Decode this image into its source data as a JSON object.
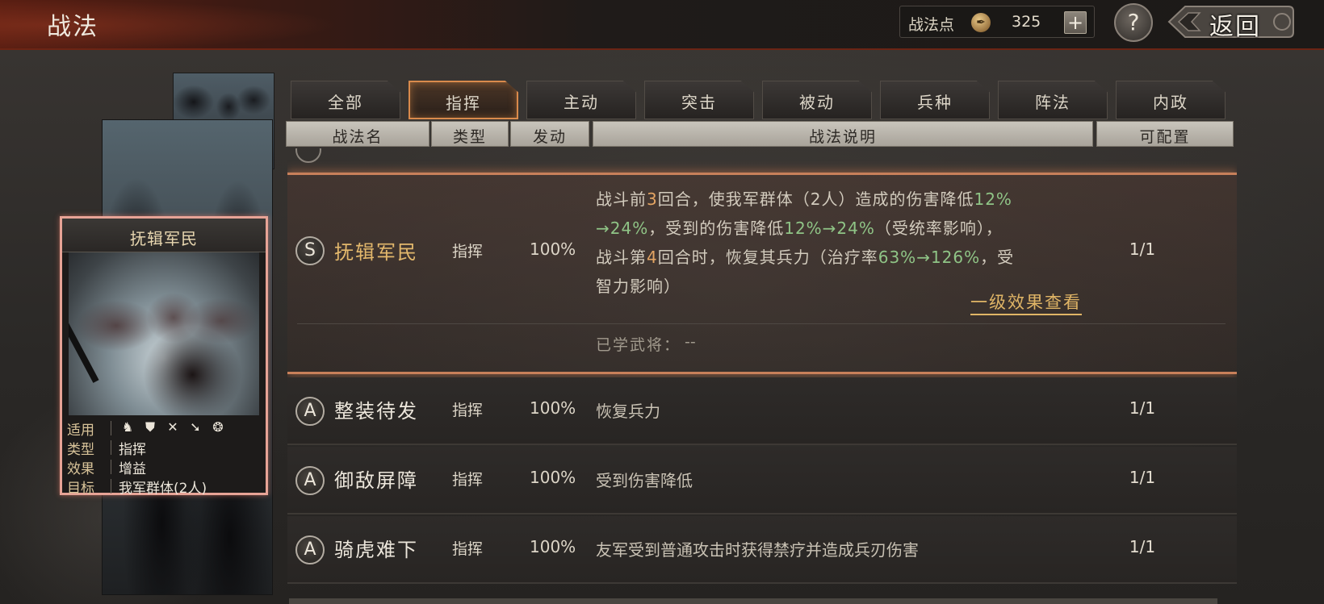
{
  "header": {
    "title": "战法",
    "points_label": "战法点",
    "points_value": "325",
    "add_label": "+",
    "help_label": "?",
    "back_label": "返回"
  },
  "card": {
    "name": "抚辑军民",
    "rows": [
      {
        "key": "适用",
        "icons": [
          "cavalry-icon",
          "shield-icon",
          "bow-icon",
          "spear-icon",
          "wheel-icon"
        ]
      },
      {
        "key": "类型",
        "value": "指挥"
      },
      {
        "key": "效果",
        "value": "增益"
      },
      {
        "key": "目标",
        "value": "我军群体(2人)"
      }
    ]
  },
  "tabs": [
    {
      "label": "全部",
      "active": false
    },
    {
      "label": "指挥",
      "active": true
    },
    {
      "label": "主动",
      "active": false
    },
    {
      "label": "突击",
      "active": false
    },
    {
      "label": "被动",
      "active": false
    },
    {
      "label": "兵种",
      "active": false
    },
    {
      "label": "阵法",
      "active": false
    },
    {
      "label": "内政",
      "active": false
    }
  ],
  "columns": {
    "name": "战法名",
    "type": "类型",
    "trigger": "发动",
    "desc": "战法说明",
    "slots": "可配置"
  },
  "expanded": {
    "grade": "S",
    "name": "抚辑军民",
    "type": "指挥",
    "rate": "100%",
    "slots": "1/1",
    "desc_lines": [
      "战斗前3回合，使我军群体（2人）造成的伤害降低12%",
      "→24%，受到的伤害降低12%→24%（受统率影响），",
      "战斗第4回合时，恢复其兵力（治疗率63%→126%，受",
      "智力影响）"
    ],
    "tier_link": "一级效果查看",
    "learned_label": "已学武将：",
    "learned_value": "--"
  },
  "rows": [
    {
      "grade": "A",
      "name": "整装待发",
      "type": "指挥",
      "rate": "100%",
      "desc": "恢复兵力",
      "slots": "1/1"
    },
    {
      "grade": "A",
      "name": "御敌屏障",
      "type": "指挥",
      "rate": "100%",
      "desc": "受到伤害降低",
      "slots": "1/1"
    },
    {
      "grade": "A",
      "name": "骑虎难下",
      "type": "指挥",
      "rate": "100%",
      "desc": "友军受到普通攻击时获得禁疗并造成兵刃伤害",
      "slots": "1/1"
    }
  ],
  "colors": {
    "accent": "#d98a4c",
    "highlight_name": "#e3b86c",
    "number_orange": "#e3a463",
    "number_green": "#8fc486",
    "card_border": "#e7a396"
  }
}
